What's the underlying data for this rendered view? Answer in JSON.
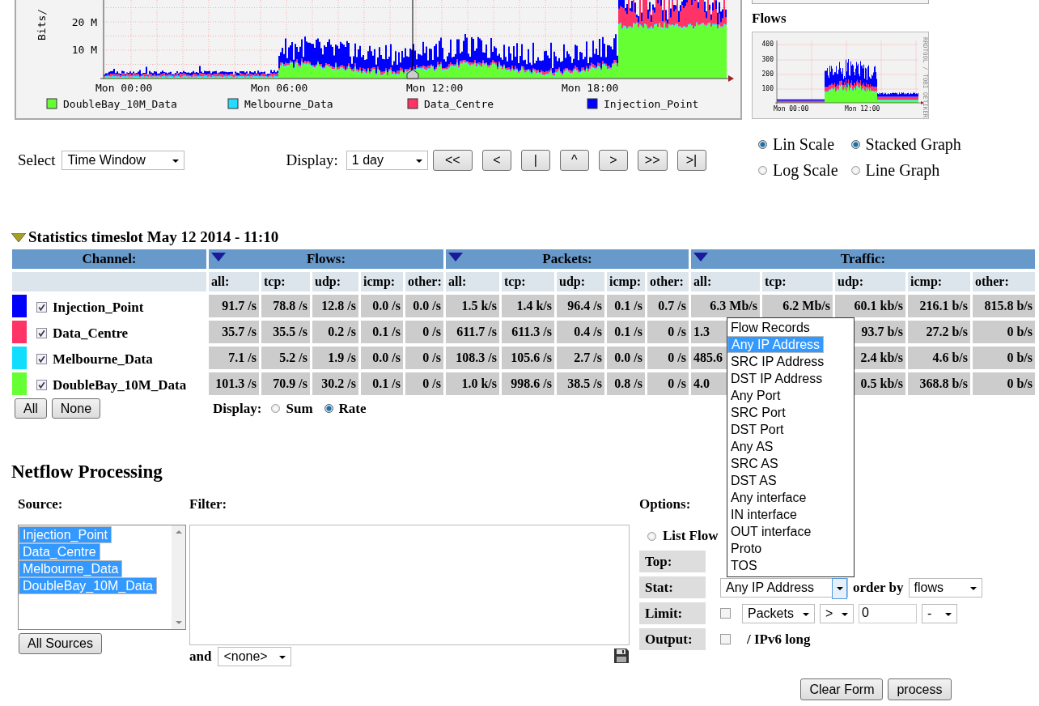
{
  "traffic_graph": {
    "y_label": "Bits/",
    "y_ticks": [
      "20 M",
      "10 M"
    ],
    "x_ticks": [
      "Mon 00:00",
      "Mon 06:00",
      "Mon 12:00",
      "Mon 18:00"
    ],
    "legend": [
      {
        "name": "DoubleBay_10M_Data",
        "color": "#66ff33"
      },
      {
        "name": "Melbourne_Data",
        "color": "#22ddff"
      },
      {
        "name": "Data_Centre",
        "color": "#ff3366"
      },
      {
        "name": "Injection_Point",
        "color": "#0000ff"
      }
    ]
  },
  "flows_graph": {
    "title": "Flows",
    "y_ticks": [
      "400",
      "300",
      "200",
      "100"
    ],
    "x_ticks": [
      "Mon 00:00",
      "Mon 12:00"
    ],
    "credit": "RRDTOOL / TOBI OETIKER"
  },
  "select_label": "Select",
  "select_value": "Time Window",
  "display_label": "Display:",
  "display_value": "1 day",
  "nav_buttons": [
    "<<",
    "<",
    "|",
    "^",
    ">",
    ">>",
    ">|"
  ],
  "scale_options": [
    {
      "label": "Lin Scale",
      "selected": true
    },
    {
      "label": "Log Scale",
      "selected": false
    }
  ],
  "graph_type_options": [
    {
      "label": "Stacked Graph",
      "selected": true
    },
    {
      "label": "Line Graph",
      "selected": false
    }
  ],
  "statistics": {
    "title": "Statistics timeslot May 12 2014 - 11:10",
    "channel_header": "Channel:",
    "groups": [
      {
        "name": "Flows:",
        "columns": [
          "all:",
          "tcp:",
          "udp:",
          "icmp:",
          "other:"
        ]
      },
      {
        "name": "Packets:",
        "columns": [
          "all:",
          "tcp:",
          "udp:",
          "icmp:",
          "other:"
        ]
      },
      {
        "name": "Traffic:",
        "columns": [
          "all:",
          "tcp:",
          "udp:",
          "icmp:",
          "other:"
        ]
      }
    ],
    "rows": [
      {
        "name": "Injection_Point",
        "color": "#0000ff",
        "checked": true,
        "cells": [
          "91.7 /s",
          "78.8 /s",
          "12.8 /s",
          "0.0 /s",
          "0.0 /s",
          "1.5 k/s",
          "1.4 k/s",
          "96.4 /s",
          "0.1 /s",
          "0.7 /s",
          "6.3 Mb/s",
          "6.2 Mb/s",
          "60.1 kb/s",
          "216.1 b/s",
          "815.8 b/s"
        ]
      },
      {
        "name": "Data_Centre",
        "color": "#ff3366",
        "checked": true,
        "cells": [
          "35.7 /s",
          "35.5 /s",
          "0.2 /s",
          "0.1 /s",
          "0 /s",
          "611.7 /s",
          "611.3 /s",
          "0.4 /s",
          "0.1 /s",
          "0 /s",
          {
            "text": "1.3",
            "clipped": true
          },
          null,
          "93.7 b/s",
          "27.2 b/s",
          "0 b/s"
        ]
      },
      {
        "name": "Melbourne_Data",
        "color": "#11ddff",
        "checked": true,
        "cells": [
          "7.1 /s",
          "5.2 /s",
          "1.9 /s",
          "0.0 /s",
          "0 /s",
          "108.3 /s",
          "105.6 /s",
          "2.7 /s",
          "0.0 /s",
          "0 /s",
          {
            "text": "485.6",
            "clipped": true
          },
          null,
          "2.4 kb/s",
          "4.6 b/s",
          "0 b/s"
        ]
      },
      {
        "name": "DoubleBay_10M_Data",
        "color": "#66ff33",
        "checked": true,
        "cells": [
          "101.3 /s",
          "70.9 /s",
          "30.2 /s",
          "0.1 /s",
          "0 /s",
          "1.0 k/s",
          "998.6 /s",
          "38.5 /s",
          "0.8 /s",
          "0 /s",
          {
            "text": "4.0",
            "clipped": true
          },
          null,
          "0.5 kb/s",
          "368.8 b/s",
          "0 b/s"
        ]
      }
    ],
    "buttons": [
      "All",
      "None"
    ],
    "display_label": "Display:",
    "display_options": [
      {
        "label": "Sum",
        "selected": false
      },
      {
        "label": "Rate",
        "selected": true
      }
    ]
  },
  "netflow": {
    "title": "Netflow Processing",
    "source_label": "Source:",
    "sources": [
      {
        "label": "Injection_Point",
        "selected": true
      },
      {
        "label": "Data_Centre",
        "selected": true
      },
      {
        "label": "Melbourne_Data",
        "selected": true
      },
      {
        "label": "DoubleBay_10M_Data",
        "selected": true
      }
    ],
    "all_sources_button": "All Sources",
    "filter_label": "Filter:",
    "and_label": "and",
    "and_value": "<none>",
    "options_label": "Options:",
    "list_flows": {
      "label": "List Flow",
      "selected": false
    },
    "top_label": "Top:",
    "stat_label": "Stat:",
    "stat_value": "Any IP Address",
    "order_by_label": "order by",
    "order_by_value": "flows",
    "limit_label": "Limit:",
    "limit_checked": false,
    "limit_field": "Packets",
    "limit_op": ">",
    "limit_value": "0",
    "limit_unit": "-",
    "output_label": "Output:",
    "output_checked": false,
    "output_text": "/ IPv6 long",
    "buttons": [
      "Clear Form",
      "process"
    ]
  },
  "stat_dropdown": {
    "items": [
      {
        "label": "Flow Records",
        "selected": false
      },
      {
        "label": "Any IP Address",
        "selected": true
      },
      {
        "label": "SRC IP Address",
        "selected": false
      },
      {
        "label": "DST IP Address",
        "selected": false
      },
      {
        "label": "Any Port",
        "selected": false
      },
      {
        "label": "SRC Port",
        "selected": false
      },
      {
        "label": "DST Port",
        "selected": false
      },
      {
        "label": "Any AS",
        "selected": false
      },
      {
        "label": "SRC AS",
        "selected": false
      },
      {
        "label": "DST AS",
        "selected": false
      },
      {
        "label": "Any interface",
        "selected": false
      },
      {
        "label": "IN interface",
        "selected": false
      },
      {
        "label": "OUT interface",
        "selected": false
      },
      {
        "label": "Proto",
        "selected": false
      },
      {
        "label": "TOS",
        "selected": false
      }
    ]
  }
}
